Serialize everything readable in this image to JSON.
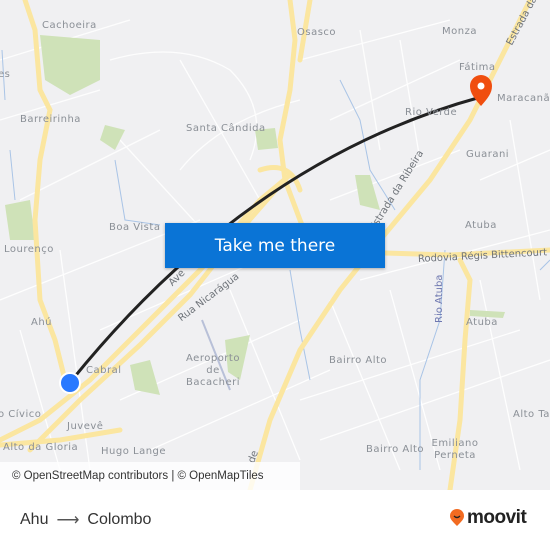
{
  "map": {
    "neighborhoods": [
      "Cachoeira",
      "Osasco",
      "Monza",
      "Fátima",
      "Maracanã",
      "Barreirinha",
      "Santa Cândida",
      "Rio Verde",
      "Guarani",
      "Boa Vista",
      "Atuba",
      "Lourenço",
      "Ahú",
      "Cabral",
      "Aeroporto de Bacacheri",
      "Bairro Alto",
      "Atuba",
      "Alto Ta",
      "Juvevê",
      "Alto da Gloria",
      "Hugo Lange",
      "Bairro Alto",
      "Emiliano Perneta",
      "o Cívico",
      "es"
    ],
    "roads": [
      "Estrada da",
      "Rodovia Régis Bittencourt",
      "Estrada da Ribeira",
      "Rua Nicarágua",
      "Ave",
      "Rio Atuba",
      "de"
    ],
    "origin_color": "#2979ff",
    "destination_color": "#f04e0f",
    "route_color": "#222222"
  },
  "cta": {
    "label": "Take me there"
  },
  "attribution": "© OpenStreetMap contributors | © OpenMapTiles",
  "trip": {
    "from": "Ahu",
    "arrow": "⟶",
    "to": "Colombo"
  },
  "brand": {
    "name": "moovit",
    "color": "#f26b21"
  }
}
